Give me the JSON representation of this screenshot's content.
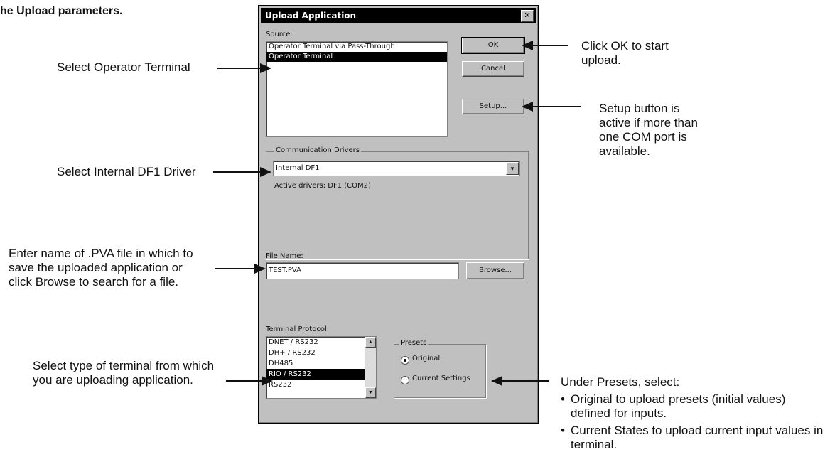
{
  "heading": "he Upload parameters.",
  "dialog": {
    "title": "Upload Application",
    "close_glyph": "✕",
    "source_label": "Source:",
    "source_items": [
      {
        "label": "Operator Terminal via Pass-Through",
        "selected": false
      },
      {
        "label": "Operator Terminal",
        "selected": true
      }
    ],
    "ok_label": "OK",
    "cancel_label": "Cancel",
    "setup_label": "Setup...",
    "drivers_label": "Communication Drivers",
    "driver_value": "Internal DF1",
    "active_drivers": "Active drivers: DF1 (COM2)",
    "file_label": "File Name:",
    "file_value": "TEST.PVA",
    "browse_label": "Browse...",
    "protocol_label": "Terminal Protocol:",
    "protocol_items": [
      {
        "label": "DNET / RS232",
        "selected": false
      },
      {
        "label": "DH+ / RS232",
        "selected": false
      },
      {
        "label": "DH485",
        "selected": false
      },
      {
        "label": "RIO / RS232",
        "selected": true
      },
      {
        "label": "RS232",
        "selected": false
      }
    ],
    "presets_label": "Presets",
    "preset_original": "Original",
    "preset_current": "Current Settings",
    "preset_selected": "Original"
  },
  "callouts": {
    "select_terminal": "Select Operator Terminal",
    "select_driver": "Select Internal DF1 Driver",
    "file_lines": [
      "Enter name of .PVA file in which to",
      "save the uploaded application or",
      "click Browse to search for a file."
    ],
    "protocol_lines": [
      "Select type of terminal from which",
      "you are uploading application."
    ],
    "ok_lines": [
      "Click OK to start",
      "upload."
    ],
    "setup_lines": [
      "Setup button is",
      "active if more than",
      "one COM port is",
      "available."
    ],
    "presets_intro": "Under Presets, select:",
    "presets_bullets": [
      "Original to upload presets (initial values) defined for inputs.",
      "Current States to upload current input values in terminal."
    ]
  },
  "icons": {
    "dropdown": "chevron-down-icon",
    "scroll_up": "scroll-up-icon",
    "scroll_down": "scroll-down-icon"
  }
}
